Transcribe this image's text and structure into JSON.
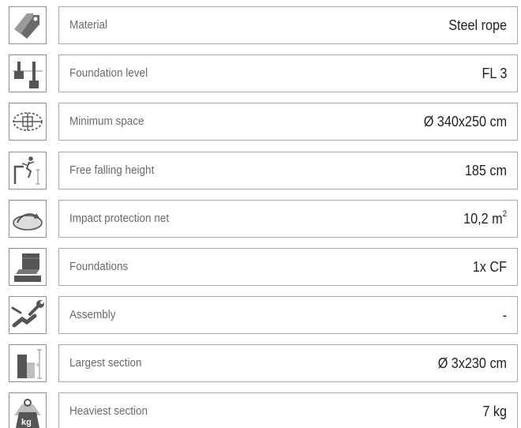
{
  "specs": [
    {
      "label": "Material",
      "value": "Steel rope",
      "icon": "price-tag-icon"
    },
    {
      "label": "Foundation level",
      "value": "FL 3",
      "icon": "foundation-level-icon"
    },
    {
      "label": "Minimum space",
      "value": "Ø 340x250 cm",
      "icon": "minimum-space-icon"
    },
    {
      "label": "Free falling height",
      "value": "185 cm",
      "icon": "falling-person-icon"
    },
    {
      "label": "Impact protection net",
      "value": "10,2 m",
      "value_sup": "2",
      "icon": "impact-area-icon"
    },
    {
      "label": "Foundations",
      "value": "1x CF",
      "icon": "concrete-foundation-icon"
    },
    {
      "label": "Assembly",
      "value": "-",
      "icon": "wrench-hand-icon"
    },
    {
      "label": "Largest section",
      "value": "Ø 3x230 cm",
      "icon": "section-size-icon"
    },
    {
      "label": "Heaviest section",
      "value": "7 kg",
      "icon": "kg-weight-icon"
    }
  ],
  "colors": {
    "icon_gray": "#555555",
    "icon_light": "#b5b5b5",
    "border": "#a8a8a8",
    "label_text": "#6a6a6a",
    "value_text": "#222222"
  }
}
